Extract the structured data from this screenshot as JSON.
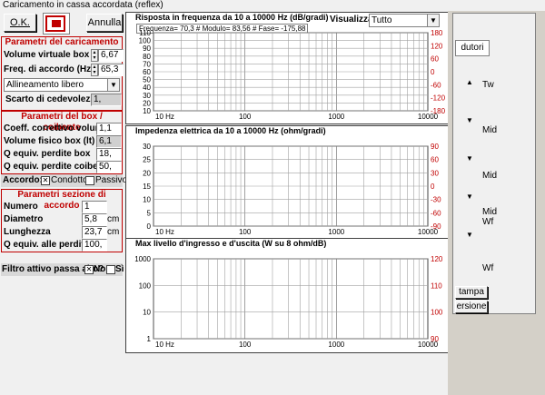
{
  "window": {
    "title": "Caricamento in cassa accordata (reflex)"
  },
  "toolbar": {
    "ok_label": "O.K.",
    "cancel_label": "Annulla"
  },
  "load_params": {
    "title": "Parametri del caricamento",
    "volume_label": "Volume virtuale box (lt)",
    "volume_value": "6,67",
    "freq_label": "Freq. di accordo (Hz)",
    "freq_value": "65,3",
    "alignment_value": "Allineamento libero",
    "discard_label": "Scarto di cedevolezza",
    "discard_value": "1,"
  },
  "box_params": {
    "title": "Parametri del box / coibente",
    "corr_label": "Coeff. correttivo volume",
    "corr_value": "1,1",
    "phys_label": "Volume fisico box (lt)",
    "phys_value": "6,1",
    "qbox_label": "Q equiv. perdite box",
    "qbox_value": "18,",
    "qcoib_label": "Q equiv. perdite coibente",
    "qcoib_value": "50,"
  },
  "tuning": {
    "label": "Accordo:",
    "conduct_label": "Condotto",
    "passive_label": "Passivo"
  },
  "tuning_params": {
    "title": "Parametri sezione di accordo",
    "num_label": "Numero",
    "num_value": "1",
    "diam_label": "Diametro",
    "diam_value": "5,8",
    "diam_unit": "cm",
    "len_label": "Lunghezza",
    "len_value": "23,7",
    "len_unit": "cm",
    "q_label": "Q equiv. alle perdite",
    "q_value": "100,"
  },
  "filter": {
    "label": "Filtro attivo passa alto?",
    "no_label": "No",
    "yes_label": "Sì"
  },
  "charts": {
    "freq": {
      "title": "Risposta in frequenza da 10 a 10000 Hz (dB/gradi)",
      "readout": "Frequenza= 70,3 # Modulo= 83,56 # Fase= -175,88",
      "view_label": "Visualizza",
      "view_value": "Tutto",
      "left_ticks": [
        "110",
        "100",
        "90",
        "80",
        "70",
        "60",
        "50",
        "40",
        "30",
        "20",
        "10"
      ],
      "right_ticks": [
        "180",
        "120",
        "60",
        "0",
        "-60",
        "-120",
        "-180"
      ],
      "x_ticks": [
        "10 Hz",
        "100",
        "1000",
        "10000"
      ]
    },
    "imp": {
      "title": "Impedenza elettrica da 10 a 10000 Hz (ohm/gradi)",
      "left_ticks": [
        "30",
        "25",
        "20",
        "15",
        "10",
        "5",
        "0"
      ],
      "right_ticks": [
        "90",
        "60",
        "30",
        "0",
        "-30",
        "-60",
        "-90"
      ],
      "x_ticks": [
        "10 Hz",
        "100",
        "1000",
        "10000"
      ]
    },
    "level": {
      "title": "Max livello d'ingresso e d'uscita (W su 8 ohm/dB)",
      "left_ticks": [
        "1000",
        "100",
        "10",
        "1"
      ],
      "right_ticks": [
        "120",
        "110",
        "100",
        "90"
      ],
      "x_ticks": [
        "10 Hz",
        "100",
        "1000",
        "10000"
      ]
    }
  },
  "right_panel": {
    "tab_label": "dutori",
    "items": [
      "Tw",
      "Mid",
      "Mid",
      "Mid Wf",
      "Wf"
    ],
    "stamp_label": "tampa",
    "version_label": "ersione"
  }
}
